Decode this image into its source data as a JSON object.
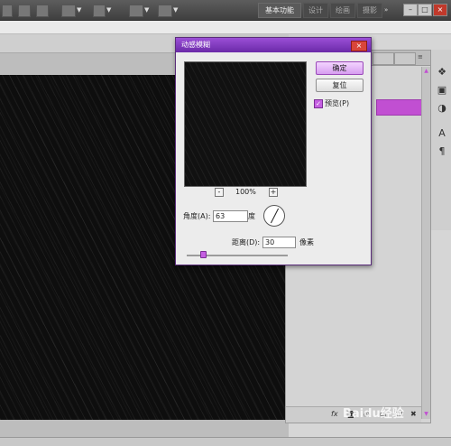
{
  "workspace": {
    "essentials_label": "基本功能",
    "other_labels": [
      "设计",
      "绘画",
      "摄影"
    ]
  },
  "dialog": {
    "title": "动感模糊",
    "ok_label": "确定",
    "reset_label": "复位",
    "preview_label": "预览(P)",
    "preview_checked": true,
    "zoom_minus": "-",
    "zoom_level": "100%",
    "zoom_plus": "+",
    "angle_label": "角度(A):",
    "angle_value": "63",
    "angle_unit": "度",
    "distance_label": "距离(D):",
    "distance_value": "30",
    "distance_unit": "像素"
  },
  "watermark": "Baidu经验",
  "colors": {
    "accent": "#c55fe2",
    "title_bar": "#7a35b8",
    "canvas": "#0e0e0e"
  },
  "icons": {
    "right_strip": [
      "swatch-icon",
      "image-icon",
      "adjustment-icon",
      "character-icon",
      "paragraph-icon"
    ],
    "panel_bottom": [
      "fx-icon",
      "mask-icon",
      "new-layer-icon",
      "delete-icon"
    ]
  }
}
